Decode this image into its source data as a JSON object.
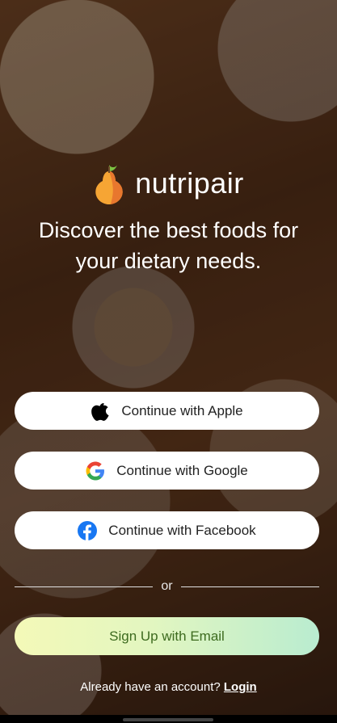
{
  "brand": {
    "name": "nutripair",
    "logo_icon": "pear-logo-icon"
  },
  "tagline": "Discover the best foods for your dietary needs.",
  "auth_buttons": [
    {
      "label": "Continue with Apple",
      "icon": "apple-icon"
    },
    {
      "label": "Continue with Google",
      "icon": "google-icon"
    },
    {
      "label": "Continue with Facebook",
      "icon": "facebook-icon"
    }
  ],
  "divider_text": "or",
  "signup_label": "Sign Up with Email",
  "login": {
    "prompt": "Already have an account?",
    "link": "Login"
  },
  "colors": {
    "signup_gradient_start": "#f4f9b8",
    "signup_gradient_end": "#b9ecd0",
    "signup_text": "#3d6b1f",
    "facebook_blue": "#1877f2"
  }
}
